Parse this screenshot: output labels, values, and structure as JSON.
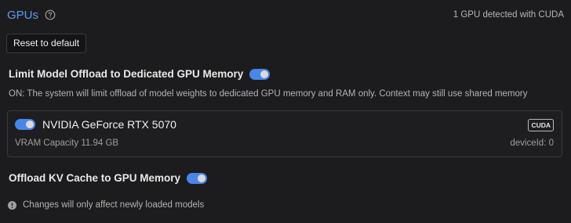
{
  "header": {
    "title": "GPUs",
    "gpu_count_text": "1 GPU detected with CUDA"
  },
  "reset_button": {
    "label": "Reset to default"
  },
  "limit_offload": {
    "label": "Limit Model Offload to Dedicated GPU Memory",
    "enabled": true,
    "description": "ON: The system will limit offload of model weights to dedicated GPU memory and RAM only. Context may still use shared memory"
  },
  "gpu_card": {
    "name": "NVIDIA GeForce RTX 5070",
    "enabled": true,
    "badge": "CUDA",
    "vram": "VRAM Capacity 11.94 GB",
    "device_id": "deviceId: 0"
  },
  "kv_cache": {
    "label": "Offload KV Cache to GPU Memory",
    "enabled": true
  },
  "notice": {
    "text": "Changes will only affect newly loaded models"
  },
  "colors": {
    "accent": "#4a86e8",
    "title": "#5b9cf5",
    "background": "#1c1c1e"
  },
  "icons": {
    "help": "question-circle-icon",
    "notice": "info-circle-icon"
  }
}
